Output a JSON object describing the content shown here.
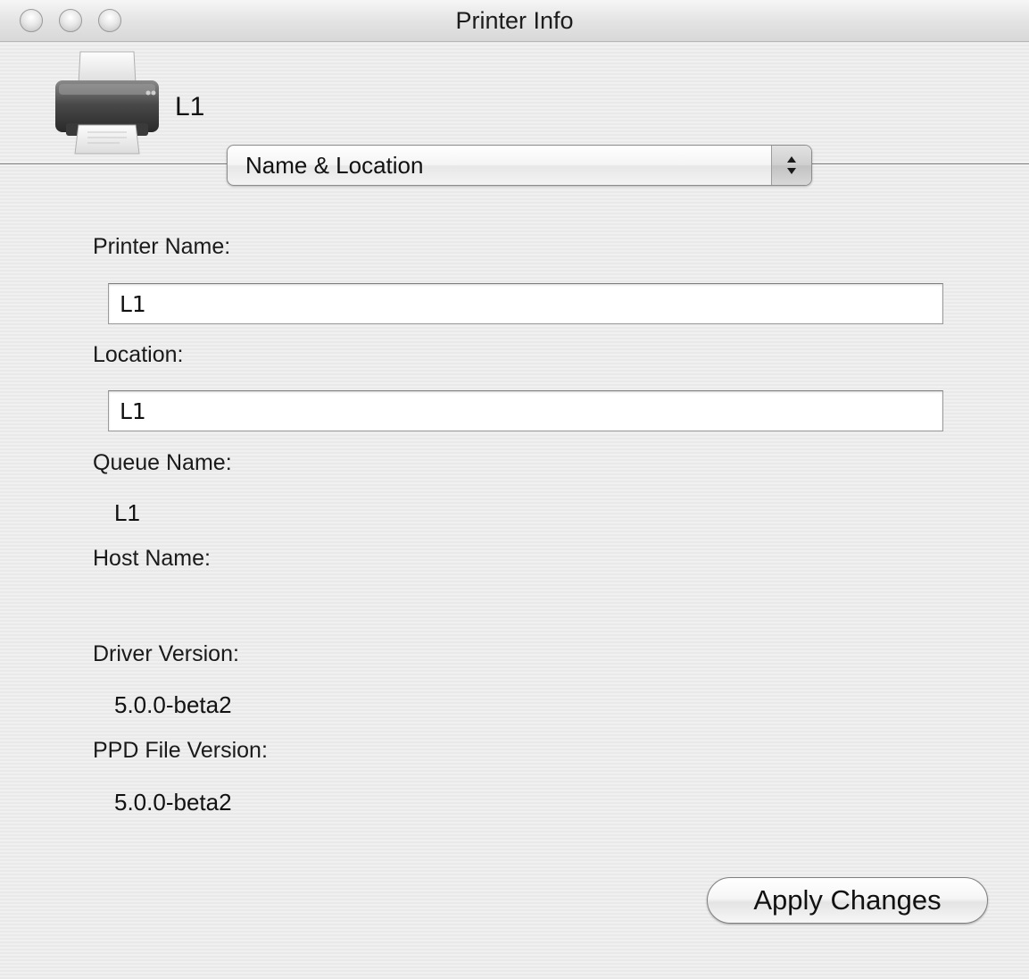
{
  "window": {
    "title": "Printer Info"
  },
  "header": {
    "printer_name": "L1",
    "printer_icon": "printer-icon"
  },
  "panel_selector": {
    "selected": "Name & Location"
  },
  "form": {
    "printer_name_label": "Printer Name:",
    "printer_name_value": "L1",
    "location_label": "Location:",
    "location_value": "L1",
    "queue_name_label": "Queue Name:",
    "queue_name_value": "L1",
    "host_name_label": "Host Name:",
    "host_name_value": "",
    "driver_version_label": "Driver Version:",
    "driver_version_value": "5.0.0-beta2",
    "ppd_version_label": "PPD File Version:",
    "ppd_version_value": "5.0.0-beta2"
  },
  "actions": {
    "apply_label": "Apply Changes"
  }
}
